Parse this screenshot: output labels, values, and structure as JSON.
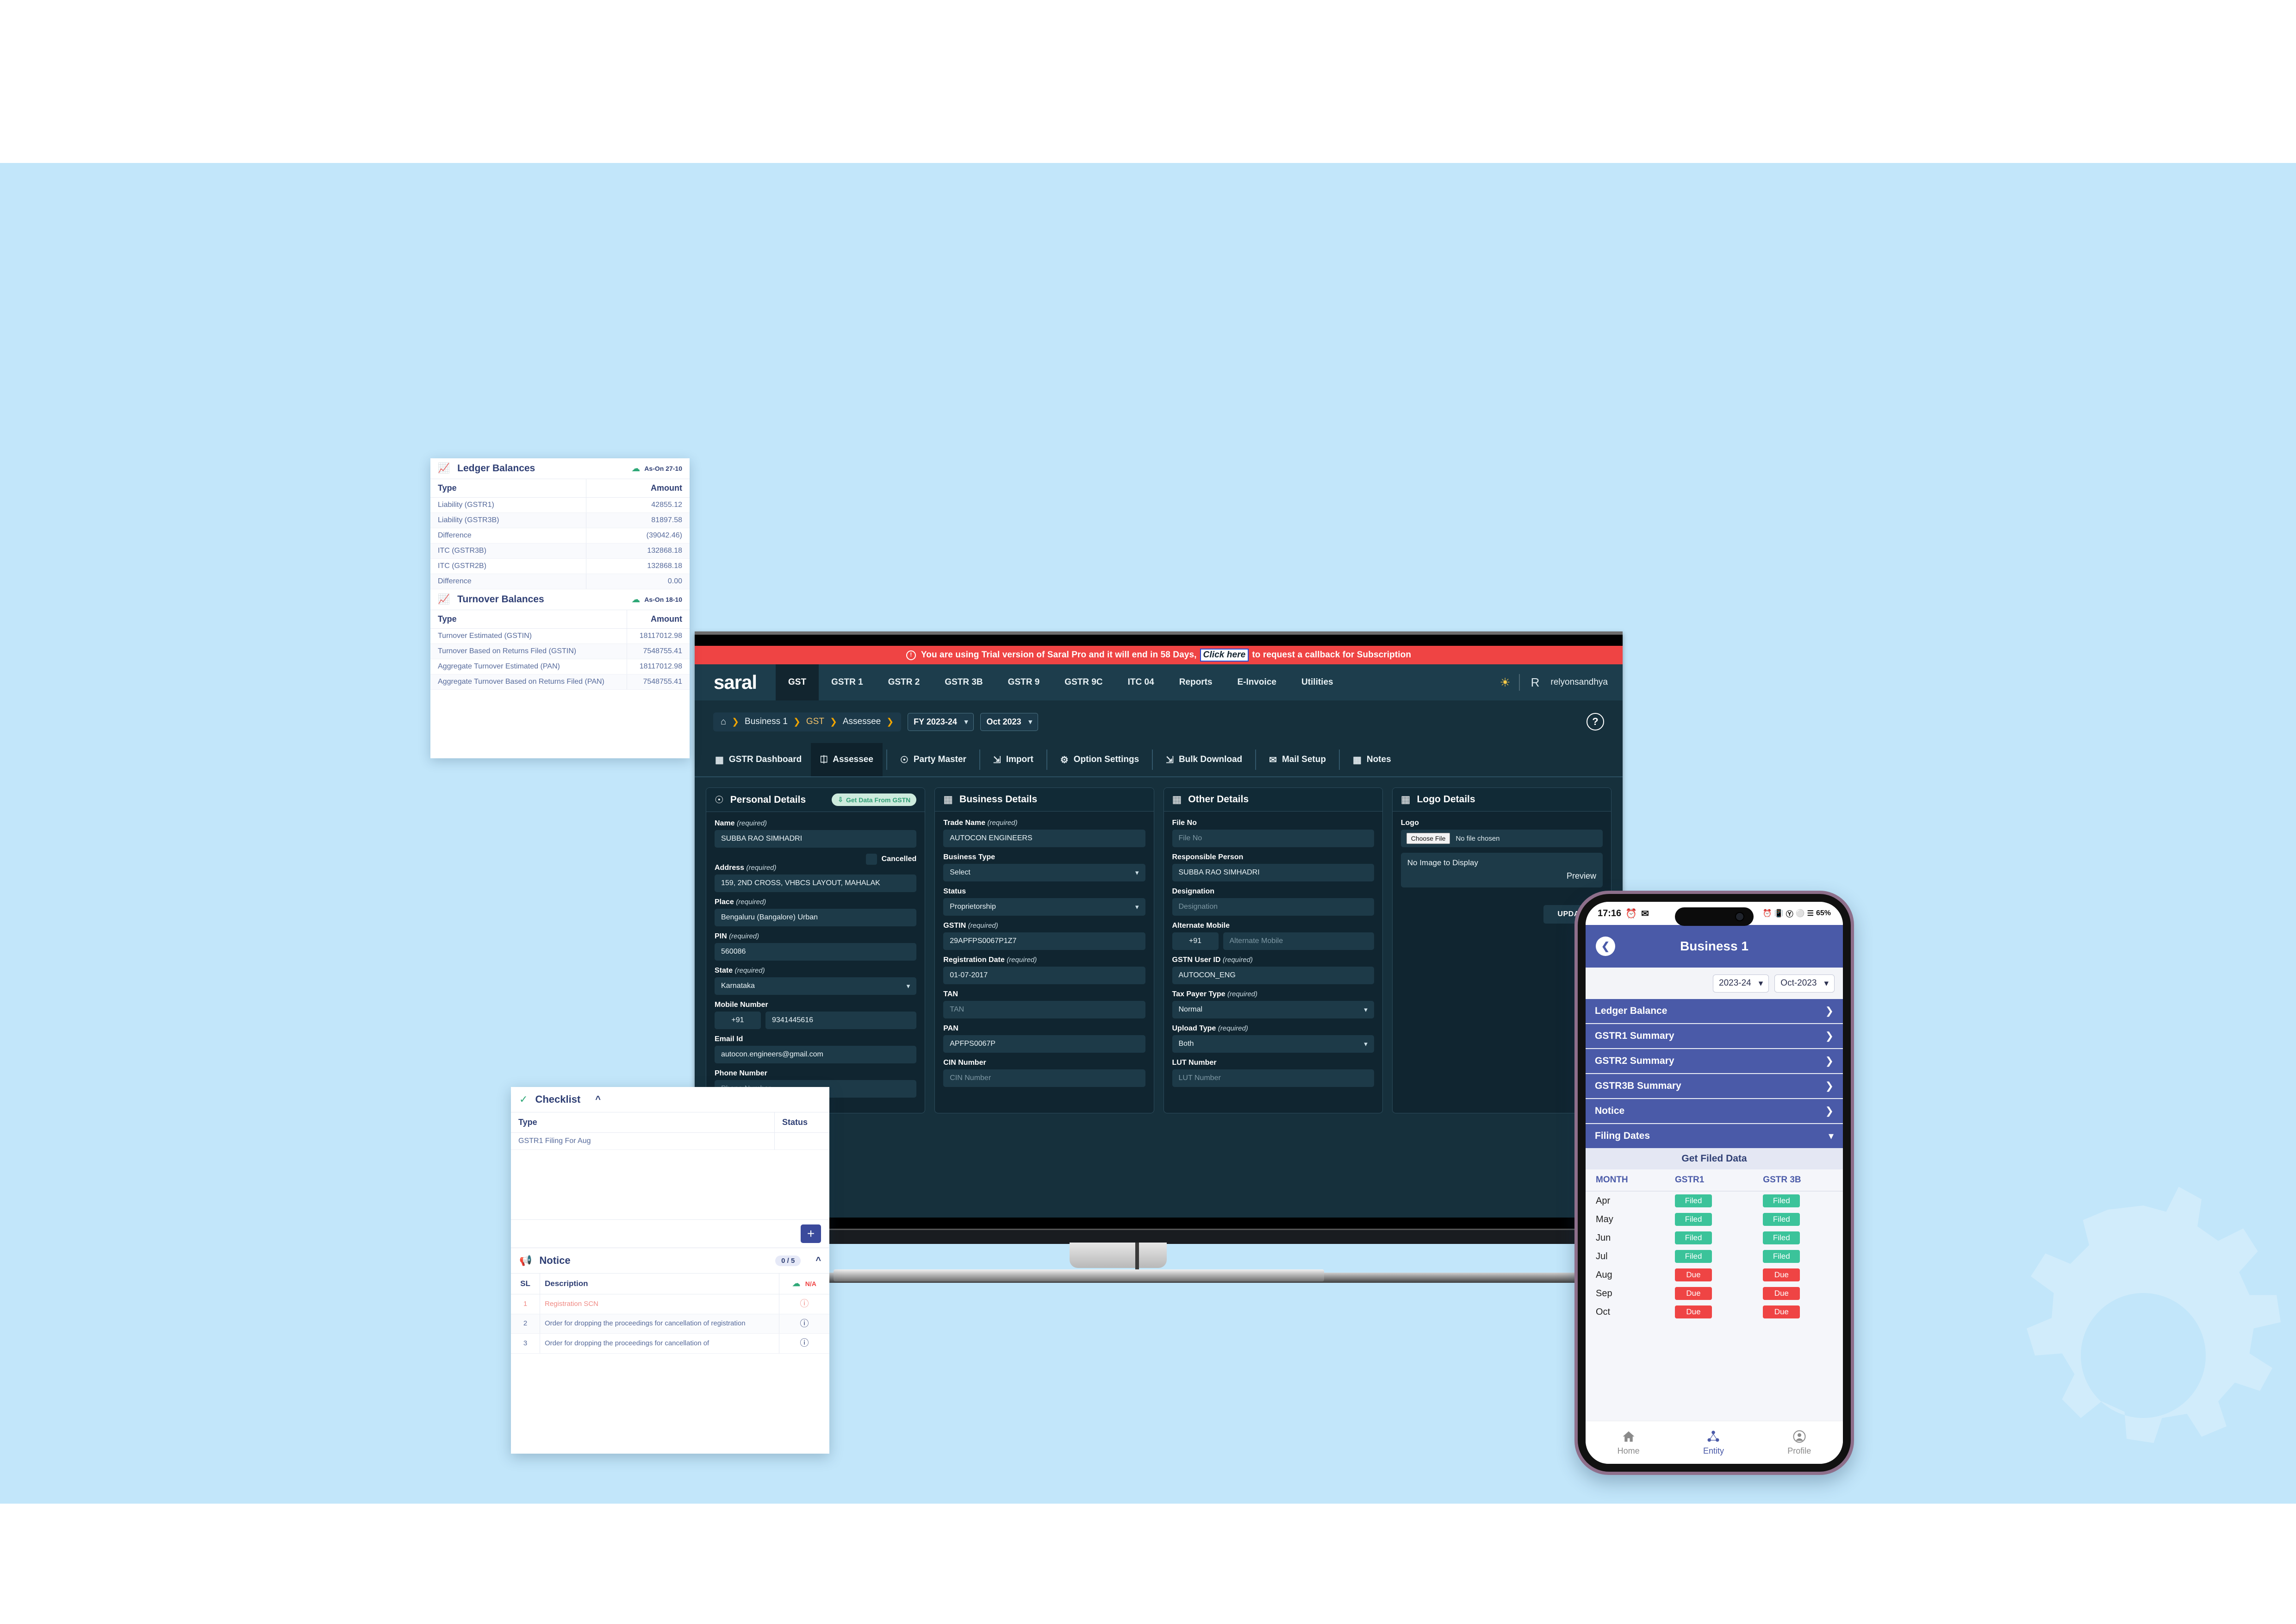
{
  "theme": {
    "canvas_bg": "#c2e6fa",
    "app_dark": "#16303c",
    "accent_red": "#ef4444",
    "accent_green": "#2fa877",
    "mobile_blue": "#4a5aa8",
    "filed_green": "#3bc39a",
    "due_red": "#ef4444"
  },
  "desktop": {
    "trial_banner": {
      "icon": "warning-circle-icon",
      "text_before": "You are using Trial version of Saral Pro and it will end in 58 Days,",
      "link_label": "Click here",
      "text_after": "to request a callback for Subscription"
    },
    "topnav": {
      "brand": "saral",
      "items": [
        {
          "label": "GST",
          "active": true
        },
        {
          "label": "GSTR 1",
          "active": false
        },
        {
          "label": "GSTR 2",
          "active": false
        },
        {
          "label": "GSTR 3B",
          "active": false
        },
        {
          "label": "GSTR 9",
          "active": false
        },
        {
          "label": "GSTR 9C",
          "active": false
        },
        {
          "label": "ITC 04",
          "active": false
        },
        {
          "label": "Reports",
          "active": false
        },
        {
          "label": "E-Invoice",
          "active": false
        },
        {
          "label": "Utilities",
          "active": false
        }
      ],
      "bell_icon": "bell-icon",
      "avatar_letter": "R",
      "username": "relyonsandhya"
    },
    "breadcrumb": {
      "home_icon": "home-icon",
      "parts": [
        "Business 1",
        "GST",
        "Assessee"
      ],
      "fy_select": "FY 2023-24",
      "month_select": "Oct 2023",
      "help_label": "?"
    },
    "toolstrip": [
      {
        "label": "GSTR Dashboard",
        "icon": "grid-icon",
        "active": false
      },
      {
        "label": "Assessee",
        "icon": "assessee-icon",
        "active": true
      },
      {
        "label": "Party Master",
        "icon": "party-icon",
        "active": false
      },
      {
        "label": "Import",
        "icon": "import-icon",
        "active": false
      },
      {
        "label": "Option Settings",
        "icon": "gear-icon",
        "active": false
      },
      {
        "label": "Bulk Download",
        "icon": "download-icon",
        "active": false
      },
      {
        "label": "Mail Setup",
        "icon": "mail-icon",
        "active": false
      },
      {
        "label": "Notes",
        "icon": "notes-icon",
        "active": false
      }
    ],
    "personal_details": {
      "title": "Personal Details",
      "gstn_button": "Get Data From GSTN",
      "cancelled_label": "Cancelled",
      "fields": [
        {
          "label": "Name",
          "req": "(required)",
          "value": "SUBBA RAO  SIMHADRI",
          "placeholder": ""
        },
        {
          "label": "Address",
          "req": "(required)",
          "value": "159, 2ND CROSS, VHBCS LAYOUT, MAHALAK",
          "placeholder": ""
        },
        {
          "label": "Place",
          "req": "(required)",
          "value": "Bengaluru (Bangalore) Urban",
          "placeholder": ""
        },
        {
          "label": "PIN",
          "req": "(required)",
          "value": "560086",
          "placeholder": ""
        },
        {
          "label": "State",
          "req": "(required)",
          "value": "Karnataka",
          "placeholder": "",
          "type": "select"
        },
        {
          "label": "Mobile Number",
          "req": "",
          "value": "9341445616",
          "prefix": "+91",
          "placeholder": ""
        },
        {
          "label": "Email Id",
          "req": "",
          "value": "autocon.engineers@gmail.com",
          "placeholder": ""
        },
        {
          "label": "Phone Number",
          "req": "",
          "value": "",
          "placeholder": "Phone Number"
        }
      ]
    },
    "business_details": {
      "title": "Business Details",
      "fields": [
        {
          "label": "Trade Name",
          "req": "(required)",
          "value": "AUTOCON ENGINEERS",
          "placeholder": ""
        },
        {
          "label": "Business Type",
          "req": "",
          "value": "Select",
          "placeholder": "",
          "type": "select"
        },
        {
          "label": "Status",
          "req": "",
          "value": "Proprietorship",
          "placeholder": "",
          "type": "select"
        },
        {
          "label": "GSTIN",
          "req": "(required)",
          "value": "29APFPS0067P1Z7",
          "placeholder": ""
        },
        {
          "label": "Registration Date",
          "req": "(required)",
          "value": "01-07-2017",
          "placeholder": ""
        },
        {
          "label": "TAN",
          "req": "",
          "value": "",
          "placeholder": "TAN"
        },
        {
          "label": "PAN",
          "req": "",
          "value": "APFPS0067P",
          "placeholder": ""
        },
        {
          "label": "CIN Number",
          "req": "",
          "value": "",
          "placeholder": "CIN Number"
        }
      ]
    },
    "other_details": {
      "title": "Other Details",
      "fields": [
        {
          "label": "File No",
          "req": "",
          "value": "",
          "placeholder": "File No"
        },
        {
          "label": "Responsible Person",
          "req": "",
          "value": "SUBBA RAO   SIMHADRI",
          "placeholder": ""
        },
        {
          "label": "Designation",
          "req": "",
          "value": "",
          "placeholder": "Designation"
        },
        {
          "label": "Alternate Mobile",
          "req": "",
          "value": "",
          "prefix": "+91",
          "placeholder": "Alternate Mobile"
        },
        {
          "label": "GSTN User ID",
          "req": "(required)",
          "value": "AUTOCON_ENG",
          "placeholder": ""
        },
        {
          "label": "Tax Payer Type",
          "req": "(required)",
          "value": "Normal",
          "placeholder": "",
          "type": "select"
        },
        {
          "label": "Upload Type",
          "req": "(required)",
          "value": "Both",
          "placeholder": "",
          "type": "select"
        },
        {
          "label": "LUT Number",
          "req": "",
          "value": "",
          "placeholder": "LUT Number"
        }
      ]
    },
    "logo_details": {
      "title": "Logo Details",
      "logo_label": "Logo",
      "choose_file": "Choose File",
      "no_file": "No file chosen",
      "no_image": "No Image to Display",
      "preview": "Preview",
      "update_button": "UPDATE"
    }
  },
  "ledger_card": {
    "ledger": {
      "title": "Ledger Balances",
      "as_on": "As-On 27-10",
      "columns": [
        "Type",
        "Amount"
      ],
      "rows": [
        {
          "type": "Liability (GSTR1)",
          "amount": "42855.12"
        },
        {
          "type": "Liability (GSTR3B)",
          "amount": "81897.58"
        },
        {
          "type": "Difference",
          "amount": "(39042.46)"
        },
        {
          "type": "ITC (GSTR3B)",
          "amount": "132868.18"
        },
        {
          "type": "ITC (GSTR2B)",
          "amount": "132868.18"
        },
        {
          "type": "Difference",
          "amount": "0.00"
        }
      ]
    },
    "turnover": {
      "title": "Turnover Balances",
      "as_on": "As-On 18-10",
      "columns": [
        "Type",
        "Amount"
      ],
      "rows": [
        {
          "type": "Turnover Estimated (GSTIN)",
          "amount": "18117012.98"
        },
        {
          "type": "Turnover Based on Returns Filed (GSTIN)",
          "amount": "7548755.41"
        },
        {
          "type": "Aggregate Turnover Estimated (PAN)",
          "amount": "18117012.98"
        },
        {
          "type": "Aggregate Turnover Based on Returns Filed (PAN)",
          "amount": "7548755.41"
        }
      ]
    }
  },
  "checklist_card": {
    "checklist": {
      "title": "Checklist",
      "columns": [
        "Type",
        "Status"
      ],
      "rows": [
        {
          "type": "GSTR1 Filing For Aug",
          "status": ""
        }
      ],
      "add_button": "+"
    },
    "notice": {
      "title": "Notice",
      "badge": "0 / 5",
      "as_on": "N/A",
      "columns": [
        "SL",
        "Description"
      ],
      "rows": [
        {
          "sl": "1",
          "desc": "Registration SCN",
          "flag": "red"
        },
        {
          "sl": "2",
          "desc": "Order for dropping the proceedings for cancellation of registration",
          "flag": ""
        },
        {
          "sl": "3",
          "desc": "Order for dropping the proceedings for cancellation of",
          "flag": ""
        }
      ]
    }
  },
  "phone": {
    "status_bar": {
      "time": "17:16",
      "left_icons": [
        "alarm-icon",
        "gmail-icon"
      ],
      "right_icons": [
        "alarm-icon",
        "vibrate-icon",
        "bluetooth-icon",
        "dnd-icon",
        "signal-icon"
      ],
      "battery": "65%"
    },
    "appbar": {
      "back_icon": "chevron-left-icon",
      "title": "Business 1"
    },
    "selectors": {
      "year": "2023-24",
      "month": "Oct-2023"
    },
    "accordion": [
      {
        "label": "Ledger Balance",
        "expanded": false
      },
      {
        "label": "GSTR1 Summary",
        "expanded": false
      },
      {
        "label": "GSTR2 Summary",
        "expanded": false
      },
      {
        "label": "GSTR3B Summary",
        "expanded": false
      },
      {
        "label": "Notice",
        "expanded": false
      },
      {
        "label": "Filing Dates",
        "expanded": true
      }
    ],
    "get_filed_data": "Get Filed Data",
    "filing_table": {
      "columns": [
        "MONTH",
        "GSTR1",
        "GSTR 3B"
      ],
      "rows": [
        {
          "month": "Apr",
          "gstr1": "Filed",
          "gstr3b": "Filed"
        },
        {
          "month": "May",
          "gstr1": "Filed",
          "gstr3b": "Filed"
        },
        {
          "month": "Jun",
          "gstr1": "Filed",
          "gstr3b": "Filed"
        },
        {
          "month": "Jul",
          "gstr1": "Filed",
          "gstr3b": "Filed"
        },
        {
          "month": "Aug",
          "gstr1": "Due",
          "gstr3b": "Due"
        },
        {
          "month": "Sep",
          "gstr1": "Due",
          "gstr3b": "Due"
        },
        {
          "month": "Oct",
          "gstr1": "Due",
          "gstr3b": "Due"
        }
      ]
    },
    "bottom_nav": [
      {
        "label": "Home",
        "icon": "home-icon",
        "active": false
      },
      {
        "label": "Entity",
        "icon": "entity-icon",
        "active": true
      },
      {
        "label": "Profile",
        "icon": "profile-icon",
        "active": false
      }
    ]
  }
}
